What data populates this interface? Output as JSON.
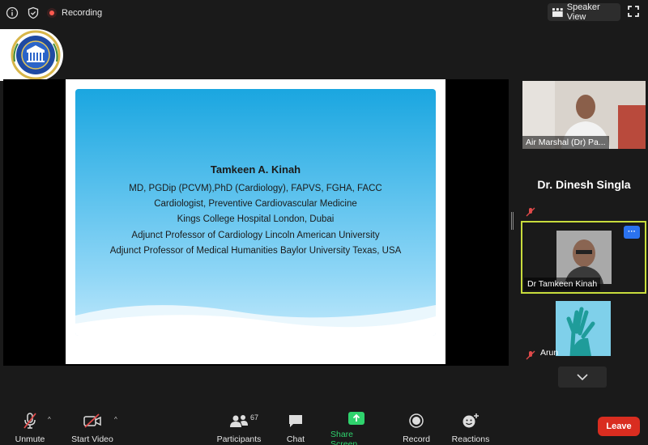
{
  "topbar": {
    "recording_label": "Recording",
    "speaker_view_label": "Speaker View",
    "icons": [
      "info-icon",
      "shield-check-icon",
      "record-icon",
      "speaker-view-icon",
      "fullscreen-icon"
    ]
  },
  "slide": {
    "name": "Tamkeen A. Kinah",
    "lines": [
      "MD, PGDip (PCVM),PhD (Cardiology), FAPVS, FGHA, FACC",
      "Cardiologist, Preventive Cardiovascular Medicine",
      "Kings College Hospital London, Dubai",
      "Adjunct Professor of Cardiology Lincoln American University"
    ],
    "last_line": "Adjunct Professor of Medical Humanities Baylor University Texas, USA"
  },
  "participants_panel": {
    "tiles": [
      {
        "name": "Air Marshal (Dr) Pa..."
      },
      {
        "big_name": "Dr. Dinesh Singla"
      },
      {
        "name": "Dr Tamkeen Kinah",
        "more_label": "···"
      },
      {
        "name": "Arun"
      }
    ]
  },
  "toolbar": {
    "unmute_label": "Unmute",
    "start_video_label": "Start Video",
    "participants_label": "Participants",
    "participants_count": "67",
    "chat_label": "Chat",
    "share_screen_label": "Share Screen",
    "record_label": "Record",
    "reactions_label": "Reactions",
    "leave_label": "Leave"
  },
  "colors": {
    "background": "#1a1a1a",
    "active_speaker_border": "#c8dc3c",
    "share_green": "#2fd36d",
    "leave_red": "#d92d20",
    "more_blue": "#2b73f0"
  }
}
